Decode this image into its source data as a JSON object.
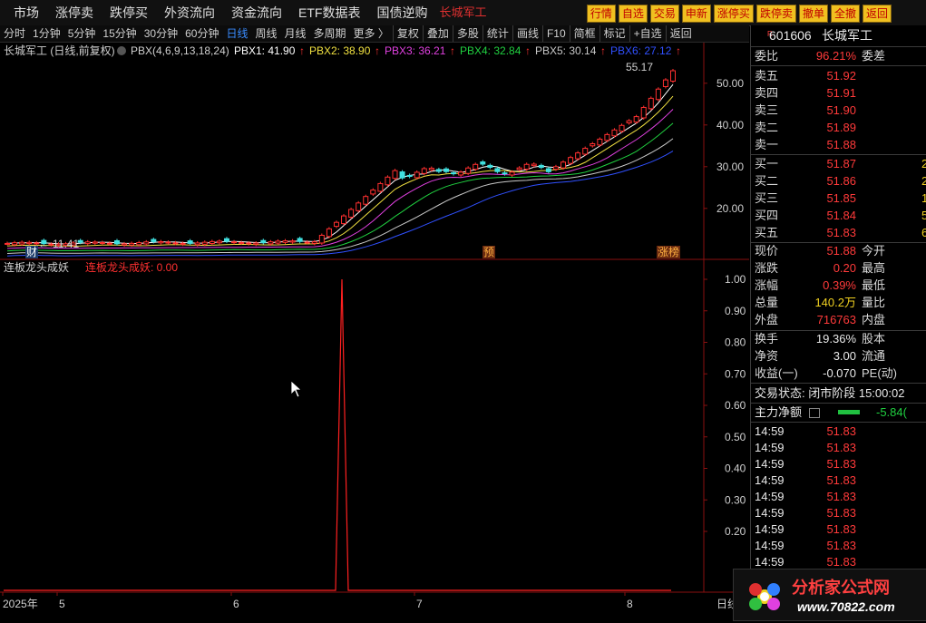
{
  "menu": {
    "items": [
      "市场",
      "涨停卖",
      "跌停买",
      "外资流向",
      "资金流向",
      "ETF数据表",
      "国债逆购"
    ],
    "extra_red": [
      "长城军工"
    ],
    "right_buttons": [
      "行情",
      "自选",
      "交易",
      "申新",
      "涨停买",
      "跌停卖",
      "撤单",
      "全撤",
      "返回"
    ]
  },
  "toolbar": {
    "items": [
      "分时",
      "1分钟",
      "5分钟",
      "15分钟",
      "30分钟",
      "60分钟",
      "日线",
      "周线",
      "月线",
      "多周期",
      "更多 〉"
    ],
    "active": "日线",
    "items2": [
      "复权",
      "叠加",
      "多股",
      "统计",
      "画线",
      "F10",
      "简框",
      "标记",
      "+自选",
      "返回"
    ]
  },
  "main_chart": {
    "title": "长城军工 (日线,前复权)",
    "indicator": "PBX(4,6,9,13,18,24)",
    "legend": [
      {
        "name": "PBX1: 41.90",
        "color": "#ffffff"
      },
      {
        "name": "PBX2: 38.90",
        "color": "#f0e040"
      },
      {
        "name": "PBX3: 36.21",
        "color": "#e040e0"
      },
      {
        "name": "PBX4: 32.84",
        "color": "#20d040"
      },
      {
        "name": "PBX5: 30.14",
        "color": "#c8c8c8"
      },
      {
        "name": "PBX6: 27.12",
        "color": "#3050ff"
      }
    ],
    "high_label": "55.17",
    "low_label": "11.41",
    "markers": [
      "财",
      "预",
      "涨榜"
    ],
    "y_ticks": [
      "50.00",
      "40.00",
      "30.00",
      "20.00"
    ]
  },
  "sub_chart": {
    "title": "连板龙头成妖",
    "value_label": "连板龙头成妖: 0.00",
    "y_ticks": [
      "1.00",
      "0.90",
      "0.80",
      "0.70",
      "0.60",
      "0.50",
      "0.40",
      "0.30",
      "0.20"
    ]
  },
  "x_axis": {
    "labels": [
      "2025年",
      "5",
      "6",
      "7",
      "8"
    ],
    "corner": "日线"
  },
  "quote": {
    "code": "601606",
    "name": "长城军工",
    "wei_bi_label": "委比",
    "wei_bi_value": "96.21%",
    "wei_cha_label": "委差",
    "asks": [
      {
        "label": "卖五",
        "price": "51.92"
      },
      {
        "label": "卖四",
        "price": "51.91"
      },
      {
        "label": "卖三",
        "price": "51.90"
      },
      {
        "label": "卖二",
        "price": "51.89"
      },
      {
        "label": "卖一",
        "price": "51.88"
      }
    ],
    "bids": [
      {
        "label": "买一",
        "price": "51.87",
        "vol": "2"
      },
      {
        "label": "买二",
        "price": "51.86",
        "vol": "2"
      },
      {
        "label": "买三",
        "price": "51.85",
        "vol": "1"
      },
      {
        "label": "买四",
        "price": "51.84",
        "vol": "5"
      },
      {
        "label": "买五",
        "price": "51.83",
        "vol": "6"
      }
    ],
    "stats": [
      {
        "l": "现价",
        "v": "51.88",
        "r": "今开",
        "c": "red"
      },
      {
        "l": "涨跌",
        "v": "0.20",
        "r": "最高",
        "c": "red"
      },
      {
        "l": "涨幅",
        "v": "0.39%",
        "r": "最低",
        "c": "red"
      },
      {
        "l": "总量",
        "v": "140.2万",
        "r": "量比",
        "c": "yel"
      },
      {
        "l": "外盘",
        "v": "716763",
        "r": "内盘",
        "c": "red"
      }
    ],
    "stats2": [
      {
        "l": "换手",
        "v": "19.36%",
        "r": "股本"
      },
      {
        "l": "净资",
        "v": "3.00",
        "r": "流通"
      },
      {
        "l": "收益(一)",
        "v": "-0.070",
        "r": "PE(动)"
      }
    ],
    "status": "交易状态: 闭市阶段 15:00:02",
    "main_net_label": "主力净额",
    "main_net_value": "-5.84(",
    "ticks": [
      {
        "t": "14:59",
        "p": "51.83"
      },
      {
        "t": "14:59",
        "p": "51.83"
      },
      {
        "t": "14:59",
        "p": "51.83"
      },
      {
        "t": "14:59",
        "p": "51.83"
      },
      {
        "t": "14:59",
        "p": "51.83"
      },
      {
        "t": "14:59",
        "p": "51.83"
      },
      {
        "t": "14:59",
        "p": "51.83"
      },
      {
        "t": "14:59",
        "p": "51.83"
      },
      {
        "t": "14:59",
        "p": "51.83"
      }
    ]
  },
  "watermark": {
    "title": "分析家公式网",
    "url": "www.70822.com"
  },
  "chart_data": {
    "type": "line",
    "title": "连板龙头成妖",
    "x": [
      "2025-05",
      "2025-06",
      "2025-07",
      "2025-08"
    ],
    "series": [
      {
        "name": "连板龙头成妖",
        "values": [
          0,
          0,
          0,
          1,
          0,
          0,
          0
        ]
      }
    ],
    "ylim": [
      0,
      1
    ]
  }
}
